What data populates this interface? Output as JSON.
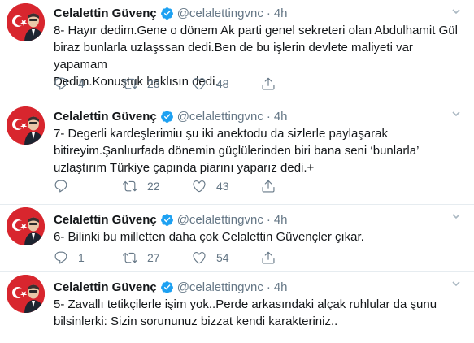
{
  "colors": {
    "text": "#14171a",
    "secondary": "#657786",
    "verified": "#1da1f2",
    "divider": "#e6ecf0",
    "avatar_bg": "#d8262e"
  },
  "tweets": [
    {
      "name": "Celalettin Güvenç",
      "handle": "@celalettingvnc",
      "dot": "·",
      "time": "4h",
      "text": "8- Hayır dedim.Gene o dönem Ak parti genel sekreteri olan Abdulhamit Gül\nbiraz bunlarla uzlaşssan dedi.Ben de bu işlerin devlete maliyeti var yapamam\nDedim.Konuştuk haklısın dedi...",
      "replies": "4",
      "retweets": "23",
      "likes": "48"
    },
    {
      "name": "Celalettin Güvenç",
      "handle": "@celalettingvnc",
      "dot": "·",
      "time": "4h",
      "text": "7- Degerli kardeşlerimiu şu iki anektodu da sizlerle paylaşarak\nbitireyim.Şanlıurfada dönemin güçlülerinden biri bana seni ‘bunlarla’\nuzlaştırım Türkiye çapında piarını yaparız dedi.+",
      "replies": "",
      "retweets": "22",
      "likes": "43"
    },
    {
      "name": "Celalettin Güvenç",
      "handle": "@celalettingvnc",
      "dot": "·",
      "time": "4h",
      "text": "6- Bilinki bu milletten daha çok Celalettin Güvençler çıkar.",
      "replies": "1",
      "retweets": "27",
      "likes": "54"
    },
    {
      "name": "Celalettin Güvenç",
      "handle": "@celalettingvnc",
      "dot": "·",
      "time": "4h",
      "text": "5- Zavallı tetikçilerle işim yok..Perde arkasındaki alçak ruhlular da şunu\nbilsinlerki: Sizin sorununuz bizzat kendi karakteriniz..",
      "replies": "",
      "retweets": "",
      "likes": ""
    }
  ]
}
